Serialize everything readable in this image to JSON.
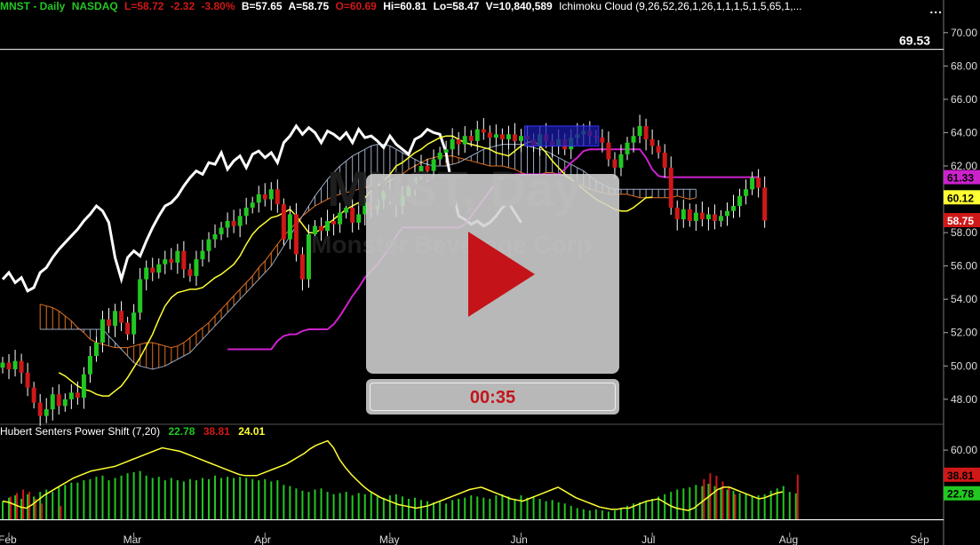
{
  "header": {
    "symbol": "MNST - Daily",
    "exchange": "NASDAQ",
    "last": "L=58.72",
    "change": "-2.32",
    "change_pct": "-3.80%",
    "bid": "B=57.65",
    "ask": "A=58.75",
    "open": "O=60.69",
    "high": "Hi=60.81",
    "low": "Lo=58.47",
    "volume": "V=10,840,589",
    "study": "Ichimoku Cloud (9,26,52,26,1,26,1,1,1,5,1,5,65,1,...",
    "menu": "..."
  },
  "indicator_header": {
    "name": "Hubert Senters Power Shift (7,20)",
    "v1": "22.78",
    "v2": "38.81",
    "v3": "24.01"
  },
  "watermark": {
    "symbol": "MNST, Day",
    "company": "Monster Beverage Corp"
  },
  "player": {
    "timer": "00:35"
  },
  "colors": {
    "background": "#000000",
    "up_candle": "#22c722",
    "down_candle": "#d01818",
    "tenkan": "#ffff33",
    "kijun": "#cc22cc",
    "chikou": "#ffffff",
    "cloud_up": "#e07020",
    "cloud_down": "#9aa8c0",
    "play_red": "#c4141a"
  },
  "chart_data": [
    {
      "type": "candlestick",
      "title": "MNST - Daily",
      "ylim": [
        46.5,
        71
      ],
      "y_ticks": [
        "70.00",
        "68.00",
        "66.00",
        "64.00",
        "62.00",
        "60.00",
        "58.00",
        "56.00",
        "54.00",
        "52.00",
        "50.00",
        "48.00"
      ],
      "x_labels": [
        "Feb",
        "Mar",
        "Apr",
        "May",
        "Jun",
        "Jul",
        "Aug",
        "Sep"
      ],
      "x_label_index": [
        1,
        21,
        42,
        62,
        83,
        104,
        126,
        147
      ],
      "price_labels": [
        {
          "text": "69.53",
          "value": 69.53,
          "bg": "#000000",
          "fg": "#ffffff"
        },
        {
          "text": "61.33",
          "value": 61.33,
          "bg": "#cc22cc",
          "fg": "#000000"
        },
        {
          "text": "60.12",
          "value": 60.12,
          "bg": "#ffff33",
          "fg": "#000000"
        },
        {
          "text": "58.75",
          "value": 58.75,
          "bg": "#d01818",
          "fg": "#ffffff"
        }
      ],
      "close": [
        50.2,
        49.8,
        50.3,
        49.6,
        48.7,
        47.8,
        47.0,
        47.4,
        48.3,
        47.6,
        48.0,
        48.4,
        48.1,
        49.5,
        50.6,
        51.4,
        52.8,
        52.4,
        53.3,
        52.6,
        51.9,
        53.2,
        55.2,
        55.9,
        55.6,
        56.1,
        56.4,
        56.2,
        56.9,
        55.8,
        55.4,
        56.4,
        56.9,
        57.6,
        57.9,
        58.3,
        58.7,
        58.4,
        59.0,
        59.5,
        59.8,
        60.3,
        60.0,
        60.6,
        59.7,
        57.6,
        59.1,
        56.7,
        55.2,
        57.9,
        58.4,
        58.1,
        58.7,
        58.5,
        59.2,
        59.5,
        58.6,
        59.1,
        59.8,
        59.4,
        60.0,
        60.5,
        60.1,
        59.6,
        60.2,
        60.8,
        61.6,
        62.0,
        61.7,
        62.4,
        62.8,
        63.0,
        63.6,
        63.3,
        63.8,
        63.5,
        64.2,
        64.0,
        63.7,
        63.9,
        63.6,
        63.9,
        63.5,
        63.8,
        63.6,
        63.2,
        63.9,
        63.5,
        63.2,
        63.6,
        63.0,
        63.7,
        63.9,
        64.1,
        63.8,
        63.7,
        63.4,
        62.4,
        61.9,
        62.7,
        63.4,
        63.8,
        64.4,
        63.6,
        63.2,
        62.8,
        61.9,
        59.5,
        58.8,
        59.4,
        58.7,
        59.2,
        58.8,
        59.1,
        58.7,
        59.0,
        59.3,
        59.6,
        60.2,
        60.6,
        61.3,
        60.7,
        58.72
      ],
      "tenkan": [
        49.6,
        49.4,
        49.1,
        48.8,
        48.6,
        48.5,
        48.3,
        48.2,
        48.2,
        48.5,
        48.8,
        49.3,
        49.9,
        50.5,
        51.2,
        51.9,
        52.8,
        53.6,
        54.1,
        54.4,
        54.5,
        54.6,
        54.6,
        54.7,
        55.0,
        55.3,
        55.5,
        55.8,
        56.1,
        56.6,
        57.3,
        57.9,
        58.3,
        58.6,
        58.9,
        59.0,
        59.2,
        59.4,
        59.0,
        58.5,
        58.0,
        58.0,
        58.2,
        58.5,
        58.8,
        59.1,
        59.4,
        59.6,
        59.8,
        60.1,
        60.5,
        60.8,
        61.1,
        61.5,
        62.0,
        62.2,
        62.5,
        62.8,
        63.0,
        63.3,
        63.5,
        63.7,
        63.8,
        63.8,
        63.6,
        63.4,
        63.3,
        63.2,
        63.1,
        63.0,
        62.8,
        62.7,
        62.6,
        62.9,
        63.2,
        63.4,
        63.5,
        63.2,
        62.8,
        62.3,
        61.9,
        61.5,
        61.2,
        60.9,
        60.6,
        60.3,
        60.0,
        59.8,
        59.6,
        59.4,
        59.3,
        59.3,
        59.5,
        59.8,
        60.1,
        60.12
      ],
      "tenkan_start": 9,
      "kijun": [
        51.0,
        51.0,
        51.0,
        51.0,
        51.0,
        51.0,
        51.0,
        51.0,
        51.5,
        51.8,
        51.9,
        51.9,
        52.1,
        52.2,
        52.2,
        52.2,
        52.2,
        52.5,
        53.0,
        53.6,
        54.2,
        54.7,
        55.3,
        55.7,
        56.1,
        56.6,
        57.1,
        57.8,
        58.3,
        58.3,
        58.3,
        58.3,
        58.3,
        58.3,
        58.3,
        58.3,
        58.3,
        58.3,
        58.5,
        59.0,
        59.5,
        60.0,
        60.5,
        61.0,
        61.3,
        61.5,
        61.5,
        61.5,
        61.5,
        61.5,
        61.5,
        61.5,
        61.5,
        61.5,
        61.8,
        62.2,
        62.5,
        62.9,
        63.0,
        63.0,
        63.0,
        63.0,
        63.0,
        63.0,
        63.0,
        63.0,
        63.0,
        62.5,
        61.8,
        61.4,
        61.33,
        61.33,
        61.33,
        61.33,
        61.33,
        61.33,
        61.33,
        61.33,
        61.33,
        61.33,
        61.33,
        61.33,
        61.33,
        61.33,
        61.33,
        61.33
      ],
      "kijun_start": 36,
      "span_a": [
        53.7,
        53.6,
        53.5,
        53.3,
        53.0,
        52.7,
        52.3,
        52.0,
        51.6,
        51.4,
        51.3,
        51.2,
        51.1,
        51.1,
        51.1,
        51.2,
        51.3,
        51.4,
        51.4,
        51.3,
        51.2,
        51.1,
        51.2,
        51.4,
        51.7,
        52.0,
        52.3,
        52.6,
        53.0,
        53.4,
        53.8,
        54.2,
        54.6,
        55.0,
        55.4,
        55.9,
        56.3,
        56.8,
        57.3,
        57.8,
        58.2,
        58.6,
        59.0,
        59.3,
        59.6,
        59.8,
        60.0,
        60.2,
        60.3,
        60.4,
        60.5,
        60.6,
        60.7,
        60.8,
        60.9,
        61.0,
        61.1,
        61.3,
        61.5,
        61.8,
        62.0,
        62.2,
        62.4,
        62.5,
        62.6,
        62.6,
        62.6,
        62.5,
        62.4,
        62.3,
        62.2,
        62.1,
        62.0,
        62.0,
        62.0,
        61.9,
        61.8,
        61.6,
        61.5,
        61.5,
        61.5,
        61.6,
        61.6,
        61.5,
        61.4,
        61.2,
        61.0,
        60.8,
        60.6,
        60.5,
        60.4,
        60.3,
        60.3,
        60.3,
        60.3,
        60.2,
        60.1,
        60.1,
        60.1,
        60.1,
        60.1,
        60.1,
        60.2,
        60.1,
        60.0,
        60.1
      ],
      "span_b": [
        52.2,
        52.2,
        52.2,
        52.2,
        52.2,
        52.2,
        52.2,
        52.2,
        52.2,
        52.2,
        52.2,
        51.8,
        51.4,
        51.0,
        50.6,
        50.2,
        50.0,
        49.9,
        49.8,
        49.9,
        50.0,
        50.2,
        50.4,
        50.6,
        50.8,
        51.2,
        51.6,
        52.0,
        52.4,
        52.8,
        53.2,
        53.6,
        54.0,
        54.4,
        54.8,
        55.2,
        55.6,
        56.0,
        56.6,
        57.2,
        57.8,
        58.4,
        59.0,
        59.6,
        60.2,
        60.7,
        61.2,
        61.6,
        62.0,
        62.3,
        62.6,
        62.8,
        63.0,
        63.2,
        63.3,
        63.3,
        63.2,
        63.0,
        62.8,
        62.6,
        62.4,
        62.2,
        62.1,
        62.0,
        62.0,
        62.0,
        62.1,
        62.2,
        62.4,
        62.6,
        62.8,
        63.0,
        63.1,
        63.2,
        63.3,
        63.3,
        63.3,
        63.3,
        63.2,
        63.1,
        63.0,
        62.9,
        62.7,
        62.5,
        62.3,
        62.1,
        61.9,
        61.7,
        61.4,
        61.1,
        60.9,
        60.7,
        60.6,
        60.6,
        60.6,
        60.6,
        60.6,
        60.6,
        60.6,
        60.6,
        60.6,
        60.6,
        60.6,
        60.6,
        60.6,
        60.6
      ],
      "cloud_start": 6,
      "chikou": [
        55.2,
        55.6,
        55.0,
        55.3,
        54.5,
        54.7,
        55.6,
        55.9,
        56.5,
        57.0,
        57.4,
        57.8,
        58.2,
        58.7,
        59.1,
        59.6,
        59.3,
        58.6,
        56.5,
        55.2,
        56.5,
        56.9,
        56.6,
        57.5,
        58.3,
        59.0,
        59.6,
        59.8,
        60.2,
        60.8,
        61.3,
        61.7,
        61.5,
        62.2,
        62.1,
        62.8,
        61.8,
        62.3,
        62.6,
        61.9,
        62.7,
        62.9,
        62.5,
        62.8,
        62.2,
        63.4,
        63.8,
        64.4,
        63.9,
        64.3,
        64.0,
        63.4,
        64.1,
        63.9,
        63.6,
        64.0,
        63.4,
        64.2,
        63.7,
        63.8,
        63.5,
        63.1,
        63.8,
        63.3,
        63.0,
        62.7,
        63.6,
        63.8,
        64.2,
        64.0,
        63.9,
        62.8,
        60.6,
        59.0,
        58.8,
        58.5,
        58.7,
        58.4,
        58.6,
        59.0,
        59.5,
        59.8,
        59.2,
        58.6
      ],
      "blue_box": {
        "start": 84,
        "end": 95,
        "low": 63.2,
        "high": 64.4
      }
    },
    {
      "type": "bar",
      "title": "Hubert Senters Power Shift (7,20)",
      "ylim": [
        -8,
        70
      ],
      "y_ticks": [
        "60.00"
      ],
      "baseline": 0,
      "value_labels": [
        {
          "text": "38.81",
          "value": 38.81,
          "bg": "#d01818",
          "fg": "#000000"
        },
        {
          "text": "22.78",
          "value": 22.78,
          "bg": "#22c722",
          "fg": "#000000"
        }
      ],
      "bars": [
        16,
        19,
        21,
        18,
        22,
        20,
        24,
        26,
        24,
        28,
        30,
        32,
        32,
        34,
        35,
        37,
        38,
        34,
        36,
        38,
        40,
        41,
        42,
        38,
        36,
        37,
        34,
        36,
        34,
        33,
        35,
        34,
        36,
        35,
        38,
        36,
        37,
        36,
        37,
        36,
        35,
        34,
        35,
        33,
        34,
        30,
        29,
        27,
        25,
        24,
        26,
        27,
        24,
        22,
        23,
        24,
        21,
        23,
        22,
        24,
        20,
        19,
        21,
        22,
        20,
        18,
        19,
        17,
        16,
        15,
        16,
        14,
        17,
        18,
        19,
        21,
        20,
        19,
        18,
        21,
        22,
        20,
        18,
        21,
        19,
        20,
        18,
        16,
        17,
        15,
        14,
        12,
        10,
        9,
        8,
        9,
        8,
        7,
        8,
        10,
        12,
        14,
        15,
        16,
        18,
        20,
        22,
        24,
        26,
        27,
        28,
        30,
        29,
        31,
        29,
        27,
        26,
        25,
        23,
        22,
        20,
        21,
        22,
        25,
        27,
        29,
        24,
        22.78
      ],
      "bar_colors_red_index": [
        1,
        2,
        3,
        4,
        5,
        6,
        9,
        112,
        113,
        114,
        115,
        116,
        117,
        127
      ],
      "red_bars": {
        "1": 20,
        "2": 23,
        "3": 26,
        "4": 24,
        "5": 18,
        "6": 14,
        "9": 12,
        "112": 35,
        "113": 40,
        "114": 38,
        "115": 33,
        "116": 28,
        "117": 22,
        "127": 38.81
      },
      "line": [
        16,
        15,
        13,
        11,
        10,
        13,
        17,
        21,
        24,
        27,
        30,
        33,
        36,
        38,
        40,
        42,
        43,
        44,
        45,
        46,
        48,
        50,
        52,
        54,
        56,
        58,
        60,
        62,
        61,
        60,
        59,
        57,
        55,
        53,
        51,
        49,
        47,
        45,
        43,
        41,
        39,
        38,
        38,
        38,
        40,
        42,
        44,
        46,
        48,
        51,
        54,
        57,
        61,
        64,
        66,
        68,
        62,
        52,
        45,
        39,
        34,
        29,
        25,
        22,
        19,
        17,
        15,
        13,
        12,
        11,
        10,
        11,
        12,
        14,
        16,
        18,
        20,
        22,
        24,
        26,
        27,
        28,
        26,
        24,
        22,
        20,
        18,
        17,
        16,
        18,
        20,
        22,
        24,
        26,
        28,
        25,
        22,
        19,
        17,
        15,
        13,
        11,
        10,
        9,
        9,
        10,
        10,
        12,
        14,
        16,
        17,
        18,
        15,
        12,
        10,
        9,
        8,
        10,
        14,
        18,
        22,
        26,
        28,
        28,
        26,
        24,
        22,
        20,
        18,
        19,
        21,
        23,
        24.01
      ],
      "line_x_scale": 0.946
    }
  ]
}
